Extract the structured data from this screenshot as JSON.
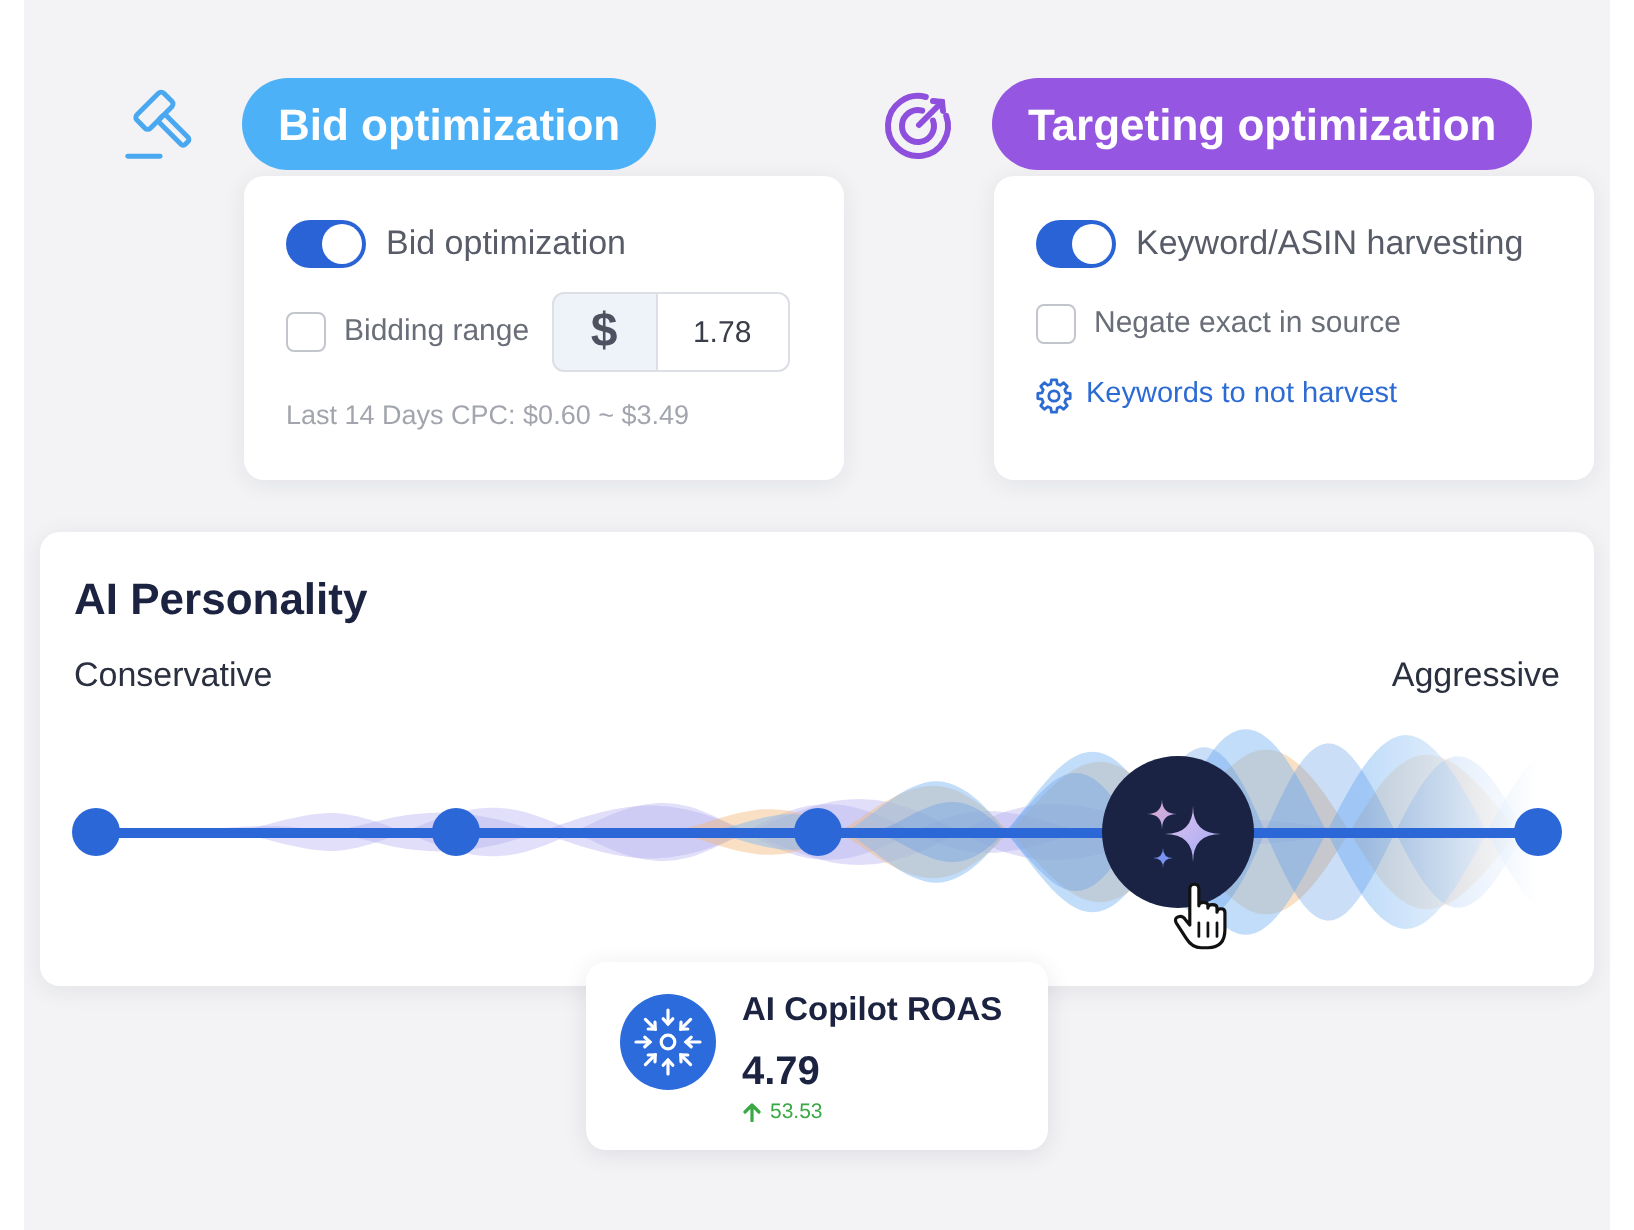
{
  "bid_optimization": {
    "title": "Bid optimization",
    "toggle": {
      "label": "Bid optimization",
      "on": true
    },
    "bidding_range": {
      "label": "Bidding range",
      "checked": false,
      "prefix": "$",
      "value": "1.78"
    },
    "cpc_note": "Last 14 Days CPC: $0.60 ~ $3.49"
  },
  "targeting_optimization": {
    "title": "Targeting optimization",
    "toggle": {
      "label": "Keyword/ASIN harvesting",
      "on": true
    },
    "negate_exact": {
      "label": "Negate exact in source",
      "checked": false
    },
    "link": "Keywords to not harvest"
  },
  "ai_personality": {
    "title": "AI Personality",
    "min_label": "Conservative",
    "max_label": "Aggressive",
    "slider": {
      "level": 0.75
    }
  },
  "roas": {
    "title": "AI Copilot ROAS",
    "value": "4.79",
    "change": {
      "increase": true,
      "value": "53.53"
    }
  }
}
